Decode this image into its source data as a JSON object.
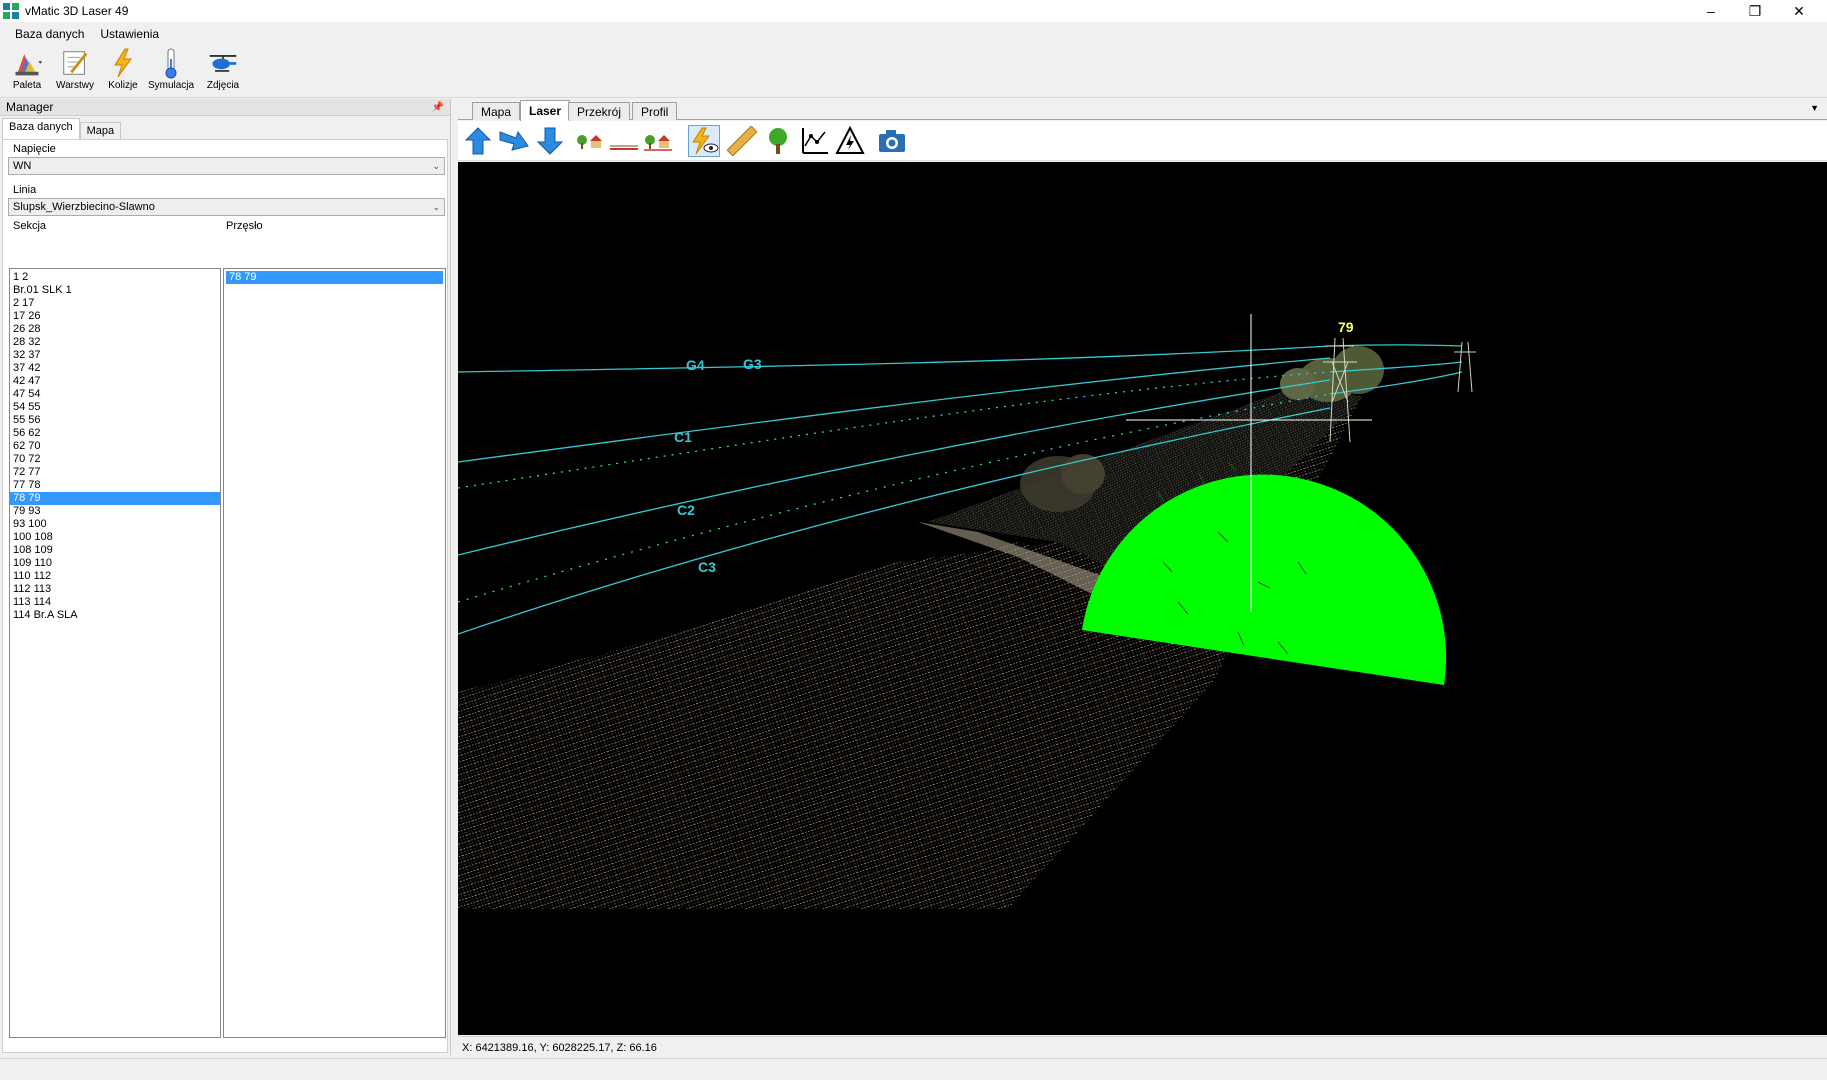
{
  "window": {
    "title": "vMatic 3D Laser 49"
  },
  "menu": {
    "items": [
      "Baza danych",
      "Ustawienia"
    ]
  },
  "ribbon": {
    "buttons": [
      {
        "label": "Paleta",
        "icon": "palette-icon"
      },
      {
        "label": "Warstwy",
        "icon": "layers-icon"
      },
      {
        "label": "Kolizje",
        "icon": "lightning-icon"
      },
      {
        "label": "Symulacja",
        "icon": "thermometer-icon"
      },
      {
        "label": "Zdjęcia",
        "icon": "helicopter-icon"
      }
    ]
  },
  "manager": {
    "title": "Manager",
    "tabs": [
      "Baza danych",
      "Mapa"
    ],
    "napiecie_label": "Napięcie",
    "napiecie_value": "WN",
    "linia_label": "Linia",
    "linia_value": "Slupsk_Wierzbiecino-Slawno",
    "sekcja_label": "Sekcja",
    "przeslo_label": "Przęsło",
    "sekcje": [
      "1 2",
      "Br.01 SLK 1",
      "2 17",
      "17 26",
      "26 28",
      "28 32",
      "32 37",
      "37 42",
      "42 47",
      "47 54",
      "54 55",
      "55 56",
      "56 62",
      "62 70",
      "70 72",
      "72 77",
      "77 78",
      "78 79",
      "79 93",
      "93 100",
      "100 108",
      "108 109",
      "109 110",
      "110 112",
      "112 113",
      "113 114",
      "114 Br.A SLA"
    ],
    "selected_sekcja": "78 79",
    "przesla": [
      "78 79"
    ],
    "selected_przeslo": "78 79"
  },
  "viewer": {
    "tabs": [
      "Mapa",
      "Laser",
      "Przekrój",
      "Profil"
    ],
    "active_tab": "Laser",
    "toolbar": [
      "arrow-up-icon",
      "arrow-forward-icon",
      "arrow-down-icon",
      "trees-houses-icon",
      "ground-line-icon",
      "trees-houses-2-icon",
      "lightning-eye-icon",
      "ruler-icon",
      "tree-icon",
      "profile-chart-icon",
      "high-voltage-icon",
      "camera-icon"
    ],
    "active_tool": "lightning-eye-icon",
    "scene": {
      "tower_label": "79",
      "wire_labels": [
        "G4",
        "G3",
        "C1",
        "C2",
        "C3"
      ],
      "zone_color": "#00ff00",
      "wire_color": "#35c9d4",
      "tower_label_color": "#ffff66"
    },
    "coords": "X: 6421389.16, Y: 6028225.17, Z: 66.16"
  }
}
